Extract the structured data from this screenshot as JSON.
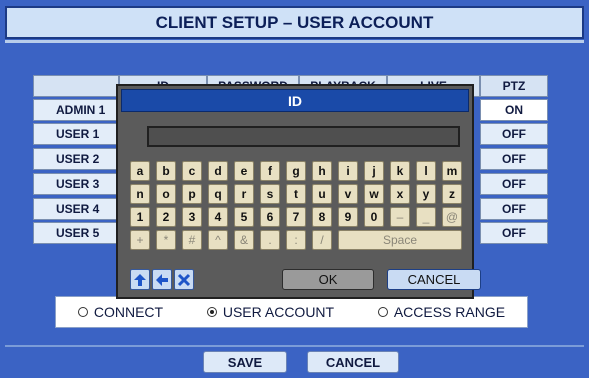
{
  "header": {
    "title": "CLIENT SETUP – USER ACCOUNT"
  },
  "table": {
    "columns": [
      "",
      "ID",
      "PASSWORD",
      "PLAYBACK",
      "LIVE",
      "PTZ"
    ],
    "rows": [
      {
        "name": "ADMIN 1",
        "ptz": "ON"
      },
      {
        "name": "USER 1",
        "ptz": "OFF"
      },
      {
        "name": "USER 2",
        "ptz": "OFF"
      },
      {
        "name": "USER 3",
        "ptz": "OFF"
      },
      {
        "name": "USER 4",
        "ptz": "OFF"
      },
      {
        "name": "USER 5",
        "ptz": "OFF"
      }
    ]
  },
  "keyboard": {
    "title": "ID",
    "input_value": "",
    "row1": [
      "a",
      "b",
      "c",
      "d",
      "e",
      "f",
      "g",
      "h",
      "i",
      "j",
      "k",
      "l",
      "m"
    ],
    "row2": [
      "n",
      "o",
      "p",
      "q",
      "r",
      "s",
      "t",
      "u",
      "v",
      "w",
      "x",
      "y",
      "z"
    ],
    "row3": [
      "1",
      "2",
      "3",
      "4",
      "5",
      "6",
      "7",
      "8",
      "9",
      "0",
      "–",
      "_",
      "@"
    ],
    "row4": [
      "+",
      "*",
      "#",
      "^",
      "&",
      ".",
      ":",
      "/"
    ],
    "space_label": "Space",
    "ok_label": "OK",
    "cancel_label": "CANCEL",
    "nav": [
      "arrow-up-icon",
      "arrow-left-icon",
      "close-icon"
    ]
  },
  "tabs": {
    "options": [
      {
        "label": "CONNECT",
        "selected": false
      },
      {
        "label": "USER ACCOUNT",
        "selected": true
      },
      {
        "label": "ACCESS RANGE",
        "selected": false
      }
    ]
  },
  "footer": {
    "save_label": "SAVE",
    "cancel_label": "CANCEL"
  },
  "colors": {
    "background": "#3b63c4",
    "title_bar": "#cfe1f7",
    "dialog_title": "#1a4aa8",
    "key": "#e8e0c2",
    "cancel_highlight": "#c9dbf3"
  }
}
